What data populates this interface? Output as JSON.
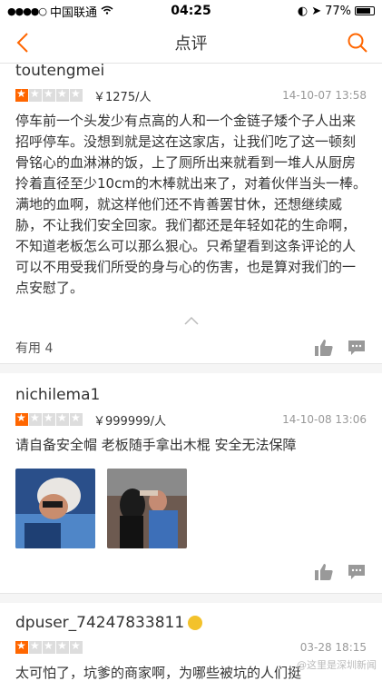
{
  "status": {
    "carrier": "中国联通",
    "time": "04:25",
    "battery": "77%"
  },
  "nav": {
    "title": "点评"
  },
  "reviews": [
    {
      "user": "toutengmei",
      "rating": 1,
      "price": "￥1275/人",
      "date": "14-10-07 13:58",
      "text": "停车前一个头发少有点高的人和一个金链子矮个子人出来招呼停车。没想到就是这在这家店，让我们吃了这一顿刻骨铭心的血淋淋的饭，上了厕所出来就看到一堆人从厨房拎着直径至少10cm的木棒就出来了，对着伙伴当头一棒。满地的血啊，就这样他们还不肯善罢甘休，还想继续威胁，不让我们安全回家。我们都还是年轻如花的生命啊，不知道老板怎么可以那么狠心。只希望看到这条评论的人可以不用受我们所受的身与心的伤害，也是算对我们的一点安慰了。",
      "useful": "有用 4"
    },
    {
      "user": "nichilema1",
      "rating": 1,
      "price": "￥999999/人",
      "date": "14-10-08 13:06",
      "text": "请自备安全帽 老板随手拿出木棍 安全无法保障"
    },
    {
      "user": "dpuser_74247833811",
      "rating": 1,
      "date": "03-28 18:15",
      "text": "太可怕了，坑爹的商家啊，为哪些被坑的人们挺"
    }
  ],
  "watermark": "@这里是深圳新闻"
}
